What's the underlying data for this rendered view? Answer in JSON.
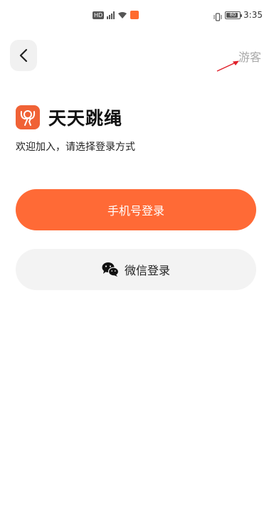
{
  "status_bar": {
    "network_badge": "HD",
    "battery": "80",
    "time": "3:35"
  },
  "nav": {
    "guest_label": "游客"
  },
  "brand": {
    "app_name": "天天跳绳",
    "subtitle": "欢迎加入，请选择登录方式"
  },
  "login": {
    "phone_label": "手机号登录",
    "wechat_label": "微信登录"
  },
  "colors": {
    "primary": "#ff6a36",
    "logo_bg": "#f06236",
    "secondary_bg": "#f3f3f3",
    "guest_text": "#a8a8a8",
    "annotation_arrow": "#e0202a"
  }
}
